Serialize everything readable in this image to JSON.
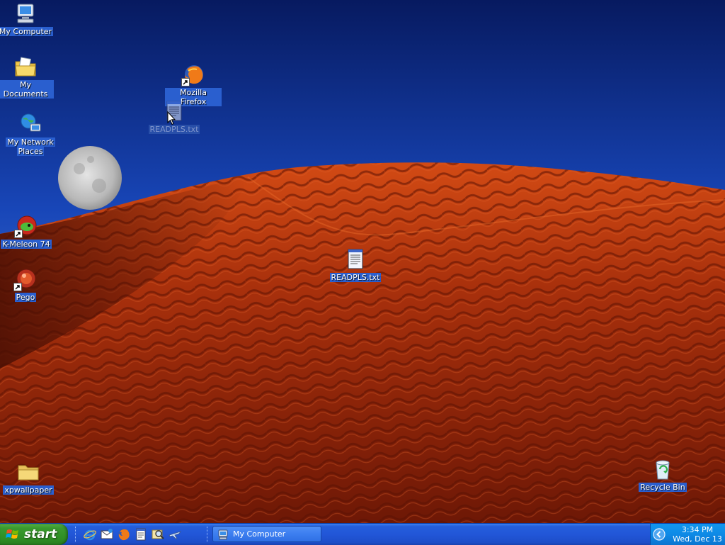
{
  "desktop": {
    "icons": {
      "my_computer": "My Computer",
      "my_documents": "My Documents",
      "network_line1": "My Network",
      "network_line2": "Places",
      "kmeleon": "K-Meleon 74",
      "pego": "Pego",
      "firefox": "Mozilla Firefox",
      "readpls_drag": "READPLS.txt",
      "readpls": "READPLS.txt",
      "xpwallpaper": "xpwallpaper",
      "recycle_bin": "Recycle Bin"
    }
  },
  "taskbar": {
    "start_label": "start",
    "quick_launch": [
      "internet-explorer-icon",
      "outlook-express-icon",
      "firefox-icon",
      "notepad-icon",
      "search-icon",
      "plane-icon"
    ],
    "tasks": [
      {
        "label": "My Computer",
        "icon": "my-computer-icon"
      }
    ],
    "clock": {
      "time": "3:34 PM",
      "date": "Wed, Dec 13"
    }
  },
  "colors": {
    "taskbar_blue": "#245edb",
    "start_green": "#3a9a2e",
    "tray_blue": "#0e8ae6",
    "sky_dark": "#0b2f8e",
    "dune_red": "#b83410"
  }
}
